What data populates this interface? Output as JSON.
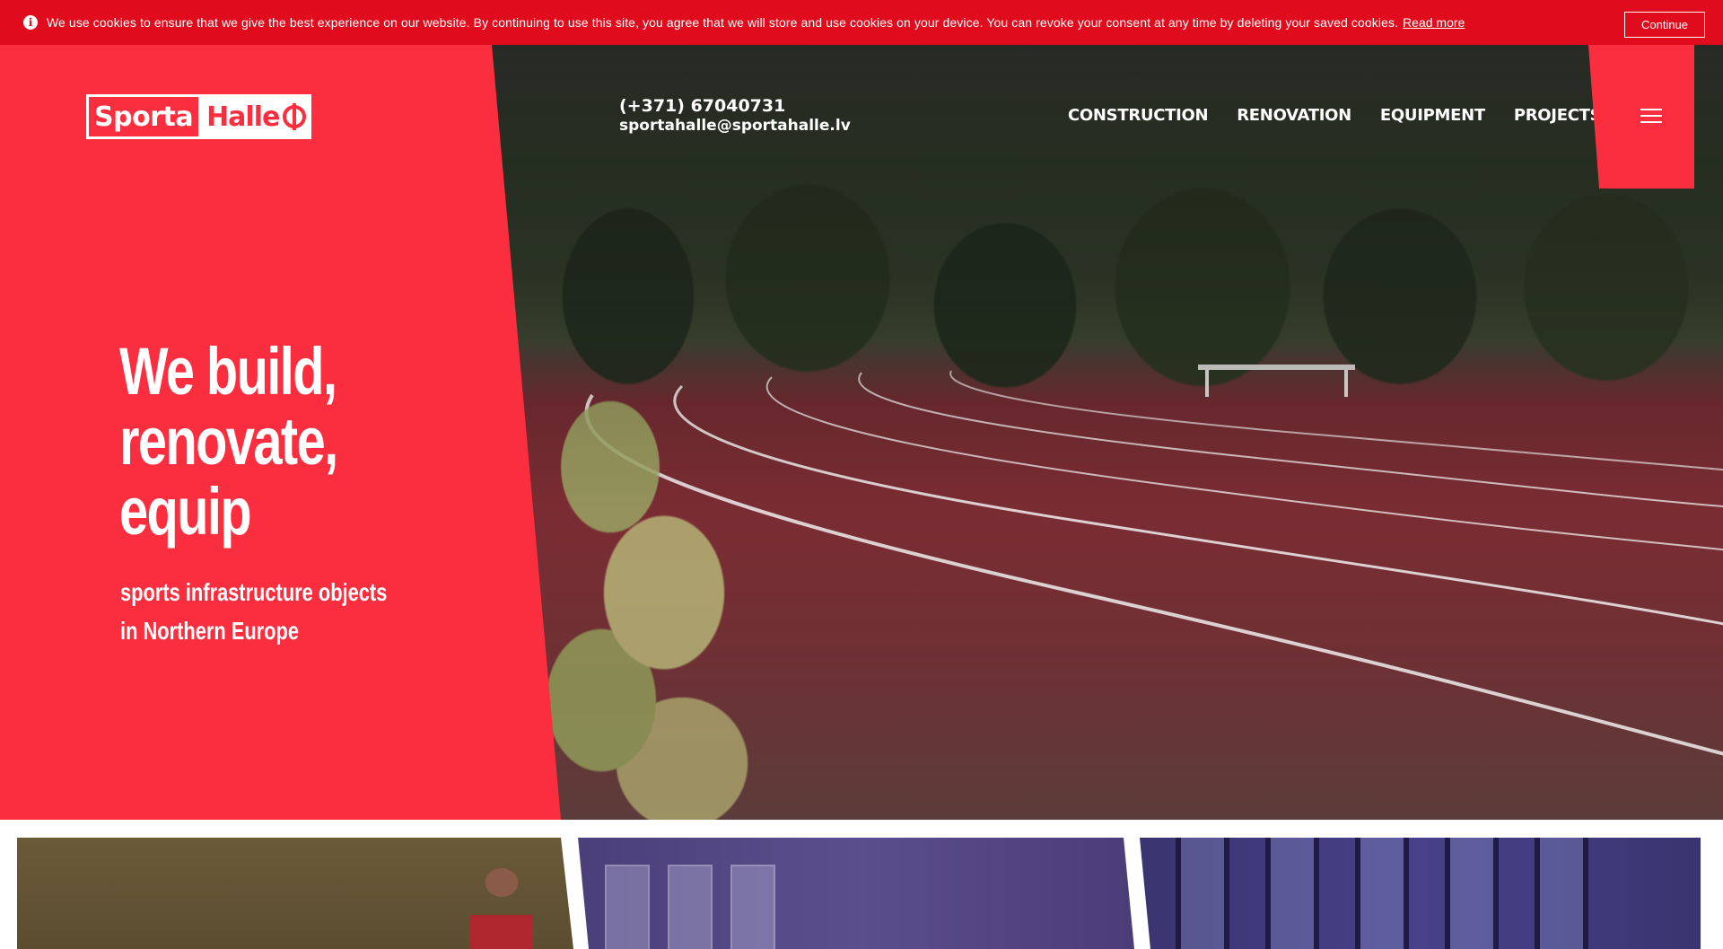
{
  "cookie_bar": {
    "info_icon": "info-icon",
    "message": "We use cookies to ensure that we give the best experience on our website. By continuing to use this site, you agree that we will store and use cookies on your device. You can revoke your consent at any time by deleting your saved cookies.",
    "read_more": "Read more",
    "continue_label": "Continue",
    "background": "#e00b1c"
  },
  "header": {
    "logo": {
      "part1": "Sporta",
      "part2": "Halle"
    },
    "contact": {
      "phone": "(+371) 67040731",
      "email": "sportahalle@sportahalle.lv"
    },
    "nav": [
      {
        "label": "CONSTRUCTION"
      },
      {
        "label": "RENOVATION"
      },
      {
        "label": "EQUIPMENT"
      },
      {
        "label": "PROJECTS"
      }
    ],
    "menu_icon": "hamburger-menu-icon"
  },
  "hero": {
    "headline": [
      "We build,",
      "renovate,",
      "equip"
    ],
    "subline": [
      "sports infrastructure objects",
      "in Northern Europe"
    ],
    "accent_color": "#fb2e3f"
  },
  "cards": [
    {
      "name": "card-construction"
    },
    {
      "name": "card-renovation"
    },
    {
      "name": "card-equipment"
    }
  ]
}
